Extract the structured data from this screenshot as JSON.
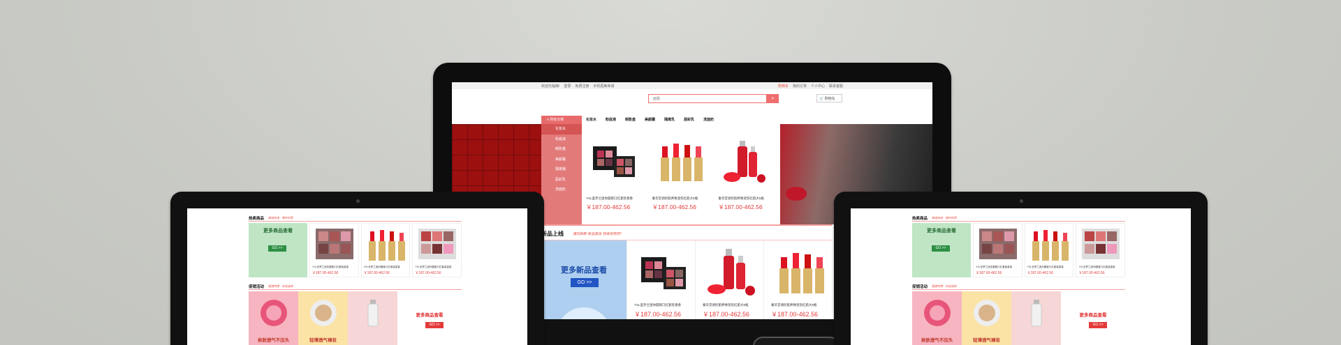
{
  "topbar": {
    "welcome": "欢迎光临韩!",
    "login": "登录",
    "register": "免费注册",
    "mobile": "手机逛美商城",
    "cart_link": "购物车",
    "orders": "我的订单",
    "center": "个人中心",
    "service": "联系客服"
  },
  "search": {
    "placeholder": "面膜",
    "cart": "购物车"
  },
  "nav": {
    "category_button": "所有分类",
    "links": [
      "化妆水",
      "粉底液",
      "眼影盘",
      "美颜霜",
      "隔离乳",
      "唇彩乳",
      "洗面奶"
    ]
  },
  "sidebar": {
    "items": [
      "化妆水",
      "粉底液",
      "眼影盘",
      "美颜霜",
      "隔离霜",
      "唇彩乳",
      "洗面奶"
    ]
  },
  "banner_products": [
    {
      "name": "YSL圣罗兰迷你圆管口红套装香香",
      "price": "￥187.00-462.56"
    },
    {
      "name": "秦华堂调控肌养致宠伤红肌大5瓶",
      "price": "￥187.00-462.56"
    },
    {
      "name": "秦华堂调控肌养致宠伤红肌大5瓶",
      "price": "￥187.00-462.56"
    }
  ],
  "new_section": {
    "title": "新品上线",
    "tagline": "潮流新款 新品首发 快来抢购吧！",
    "promo_title": "更多新品查看",
    "promo_button": "GO >>",
    "products": [
      {
        "name": "YSL圣罗兰迷你圆管口红套装香香",
        "price": "￥187.00-462.56"
      },
      {
        "name": "秦华堂调控肌养致宠伤红肌大5瓶",
        "price": "￥187.00-462.56"
      },
      {
        "name": "秦华堂调控肌养致宠伤红肌大5瓶",
        "price": "￥187.00-462.56"
      }
    ]
  },
  "tablet": {
    "hot_title": "热卖商品",
    "hot_tag": "精选热卖 · 限时优惠",
    "hot_promo": "更多商品查看",
    "hot_go": "GO >>",
    "hot_products": [
      {
        "name": "YSL圣罗兰迷你圆管口红套装香香",
        "price": "￥187.00-462.56"
      },
      {
        "name": "YSL圣罗兰迷你圆管口红套装香香",
        "price": "￥187.00-462.56"
      },
      {
        "name": "YSL圣罗兰迷你圆管口红套装香香",
        "price": "￥187.00-462.56"
      }
    ],
    "sale_title": "促销活动",
    "sale_tag": "超值特惠 · 欢迎选购",
    "sale_items": [
      "亲肤透气不压头",
      "轻薄透气裸妆",
      ""
    ],
    "sale_promo": "更多商品查看",
    "sale_go": "GO >>"
  },
  "colors": {
    "accent": "#e86b6b",
    "price": "#e43a3a",
    "blue": "#2155c3",
    "banner": "#9c1010"
  }
}
